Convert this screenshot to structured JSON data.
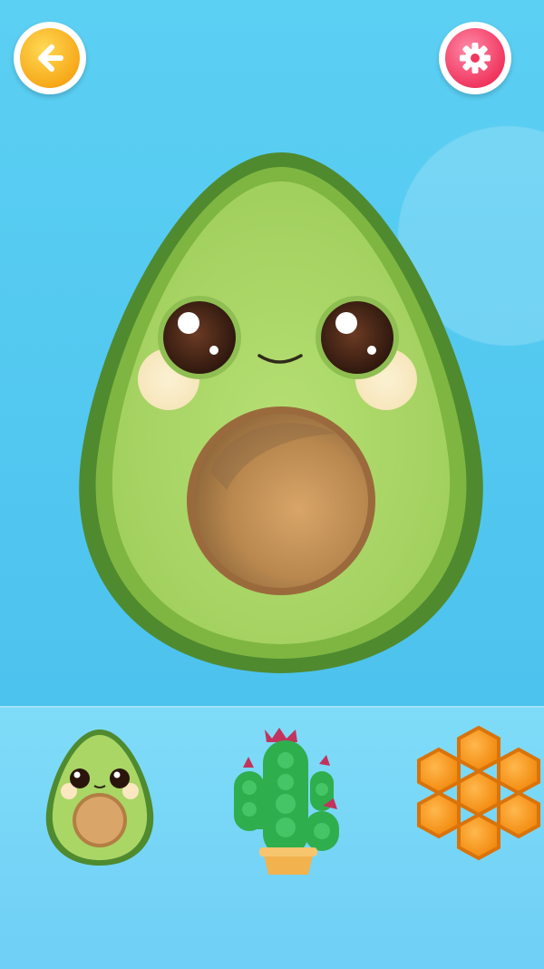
{
  "screen": {
    "colors": {
      "background": "#52c8f1",
      "tray": "#74d6f7",
      "avocado_skin": "#4f8a2f",
      "avocado_flesh": "#a9d665",
      "pit": "#b9874f",
      "back_button": "#f7a91a",
      "settings_button": "#f0375f"
    }
  },
  "header": {
    "back_button": {
      "icon": "arrow-left-icon"
    },
    "settings_button": {
      "icon": "gear-icon"
    }
  },
  "main_toy": {
    "name": "avocado-pop-it"
  },
  "tray": {
    "items": [
      {
        "name": "avocado",
        "icon": "avocado-icon",
        "selected": true
      },
      {
        "name": "cactus",
        "icon": "cactus-icon",
        "selected": false
      },
      {
        "name": "honeycomb",
        "icon": "honeycomb-icon",
        "selected": false
      }
    ]
  }
}
